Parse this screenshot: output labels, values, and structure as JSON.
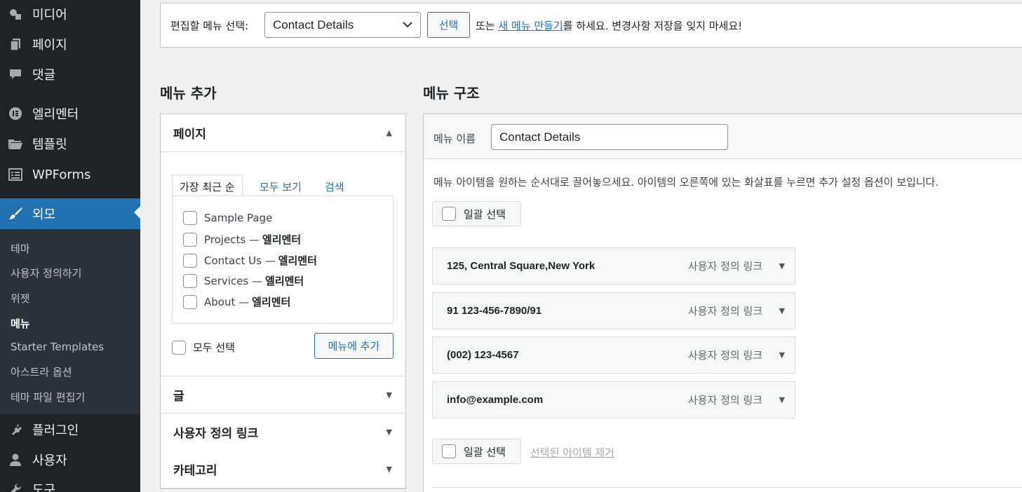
{
  "sidebar": {
    "items": [
      {
        "label": "미디어",
        "icon": "media-icon"
      },
      {
        "label": "페이지",
        "icon": "pages-icon"
      },
      {
        "label": "댓글",
        "icon": "comments-icon"
      },
      {
        "label": "엘리멘터",
        "icon": "elementor-icon"
      },
      {
        "label": "템플릿",
        "icon": "folder-icon"
      },
      {
        "label": "WPForms",
        "icon": "wpforms-icon"
      },
      {
        "label": "외모",
        "icon": "paintbrush-icon",
        "active": true
      },
      {
        "label": "플러그인",
        "icon": "plugin-icon"
      },
      {
        "label": "사용자",
        "icon": "user-icon"
      },
      {
        "label": "도구",
        "icon": "wrench-icon"
      }
    ],
    "submenu": [
      "테마",
      "사용자 정의하기",
      "위젯",
      "메뉴",
      "Starter Templates",
      "아스트라 옵션",
      "테마 파일 편집기"
    ],
    "current_sub": "메뉴"
  },
  "top_bar": {
    "label": "편집할 메뉴 선택:",
    "selected_menu": "Contact Details",
    "select_button": "선택",
    "help_prefix": "또는",
    "help_link": "새 메뉴 만들기",
    "help_suffix": "를 하세요. 변경사항 저장을 잊지 마세요!"
  },
  "add_menu": {
    "heading": "메뉴 추가",
    "pages_title": "페이지",
    "tabs": [
      "가장 최근 순",
      "모두 보기",
      "검색"
    ],
    "pages": [
      {
        "name": "Sample Page",
        "suffix": ""
      },
      {
        "name": "Projects —",
        "suffix": "엘리멘터"
      },
      {
        "name": "Contact Us —",
        "suffix": "엘리멘터"
      },
      {
        "name": "Services —",
        "suffix": "엘리멘터"
      },
      {
        "name": "About —",
        "suffix": "엘리멘터"
      }
    ],
    "select_all": "모두 선택",
    "add_button": "메뉴에 추가",
    "sections": [
      "글",
      "사용자 정의 링크",
      "카테고리"
    ]
  },
  "structure": {
    "heading": "메뉴 구조",
    "name_label": "메뉴 이름",
    "name_value": "Contact Details",
    "instructions": "메뉴 아이템을 원하는 순서대로 끌어놓으세요. 아이템의 오른쪽에 있는 화살표를 누르면 추가 설정 옵션이 보입니다.",
    "bulk_select": "일괄 선택",
    "items": [
      {
        "title": "125, Central Square,New York",
        "type": "사용자 정의 링크"
      },
      {
        "title": "91 123-456-7890/91",
        "type": "사용자 정의 링크"
      },
      {
        "title": "(002) 123-4567",
        "type": "사용자 정의 링크"
      },
      {
        "title": "info@example.com",
        "type": "사용자 정의 링크"
      }
    ],
    "remove_selected": "선택된 아이템 제거"
  }
}
